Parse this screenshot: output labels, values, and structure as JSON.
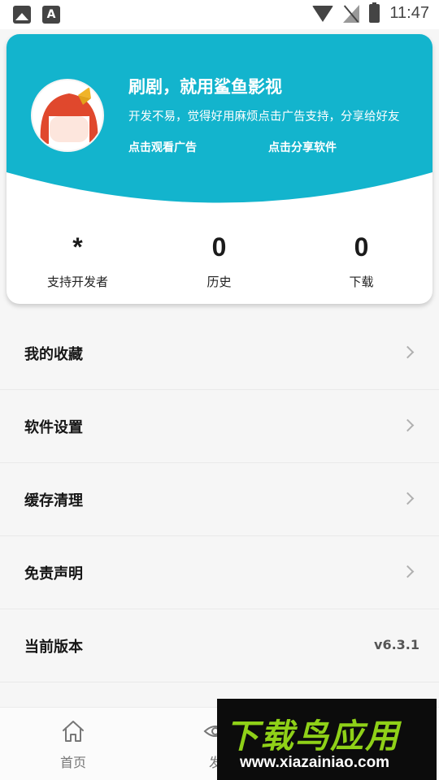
{
  "status_bar": {
    "time": "11:47",
    "left_icons": [
      "image-notification-icon",
      "font-app-icon"
    ],
    "right_icons": [
      "wifi-icon",
      "no-signal-icon",
      "battery-charging-icon"
    ],
    "app_letter": "A"
  },
  "profile": {
    "banner_color": "#13b4cd",
    "title": "刷剧，就用鲨鱼影视",
    "subtitle": "开发不易，觉得好用麻烦点击广告支持，分享给好友",
    "watch_ad_link": "点击观看广告",
    "share_link": "点击分享软件"
  },
  "stats": [
    {
      "value": "*",
      "label": "支持开发者"
    },
    {
      "value": "0",
      "label": "历史"
    },
    {
      "value": "0",
      "label": "下载"
    }
  ],
  "menu": [
    {
      "label": "我的收藏",
      "has_arrow": true
    },
    {
      "label": "软件设置",
      "has_arrow": true
    },
    {
      "label": "缓存清理",
      "has_arrow": true
    },
    {
      "label": "免责声明",
      "has_arrow": true
    },
    {
      "label": "当前版本",
      "value": "v6.3.1"
    }
  ],
  "tabbar": {
    "home_label": "首页",
    "discover_label": "发"
  },
  "watermark": {
    "brand": "下载鸟应用",
    "url": "www.xiazainiao.com",
    "brand_color": "#8fd118"
  }
}
